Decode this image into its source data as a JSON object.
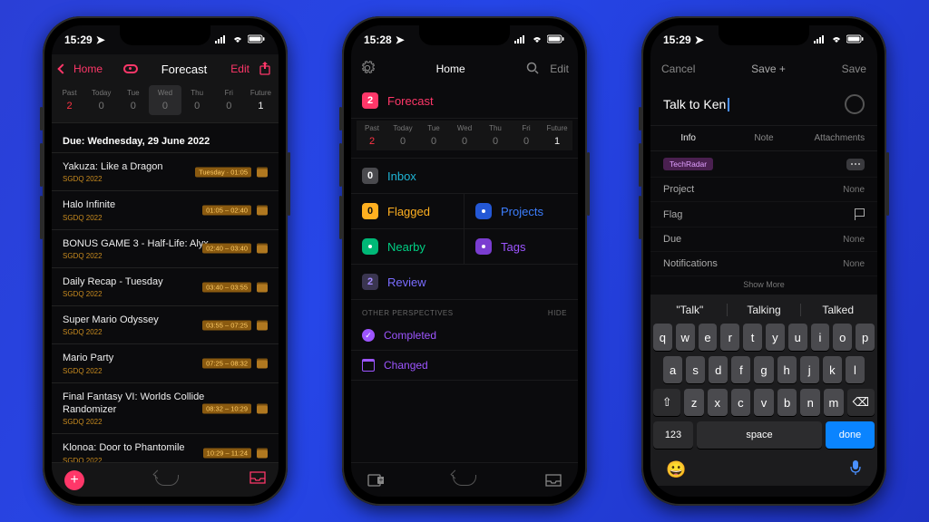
{
  "status": {
    "time_left": "15:29",
    "time_center": "15:28",
    "time_right": "15:29",
    "location_arrow": "↗"
  },
  "left": {
    "nav": {
      "back": "Home",
      "title": "Forecast",
      "edit": "Edit"
    },
    "days": [
      {
        "label": "Past",
        "count": "2",
        "cls": "red"
      },
      {
        "label": "Today",
        "count": "0",
        "cls": ""
      },
      {
        "label": "Tue",
        "count": "0",
        "cls": ""
      },
      {
        "label": "Wed",
        "count": "0",
        "cls": "",
        "sel": true
      },
      {
        "label": "Thu",
        "count": "0",
        "cls": ""
      },
      {
        "label": "Fri",
        "count": "0",
        "cls": ""
      },
      {
        "label": "Future",
        "count": "1",
        "cls": "white"
      }
    ],
    "section": "Due: Wednesday, 29 June 2022",
    "tasks": [
      {
        "title": "Yakuza: Like a Dragon",
        "sub": "SGDQ 2022",
        "badge": "Tuesday · 01:05"
      },
      {
        "title": "Halo Infinite",
        "sub": "SGDQ 2022",
        "badge": "01:05 – 02:40"
      },
      {
        "title": "BONUS GAME 3 - Half-Life: Alyx",
        "sub": "SGDQ 2022",
        "badge": "02:40 – 03:40"
      },
      {
        "title": "Daily Recap - Tuesday",
        "sub": "SGDQ 2022",
        "badge": "03:40 – 03:55"
      },
      {
        "title": "Super Mario Odyssey",
        "sub": "SGDQ 2022",
        "badge": "03:55 – 07:25"
      },
      {
        "title": "Mario Party",
        "sub": "SGDQ 2022",
        "badge": "07:25 – 08:32"
      },
      {
        "title": "Final Fantasy VI: Worlds Collide Randomizer",
        "sub": "SGDQ 2022",
        "badge": "08:32 – 10:29"
      },
      {
        "title": "Klonoa: Door to Phantomile",
        "sub": "SGDQ 2022",
        "badge": "10:29 – 11:24"
      }
    ]
  },
  "center": {
    "nav": {
      "title": "Home",
      "edit": "Edit"
    },
    "forecast": {
      "count": "2",
      "label": "Forecast"
    },
    "days": [
      {
        "label": "Past",
        "count": "2",
        "cls": "red"
      },
      {
        "label": "Today",
        "count": "0",
        "cls": ""
      },
      {
        "label": "Tue",
        "count": "0",
        "cls": ""
      },
      {
        "label": "Wed",
        "count": "0",
        "cls": ""
      },
      {
        "label": "Thu",
        "count": "0",
        "cls": ""
      },
      {
        "label": "Fri",
        "count": "0",
        "cls": ""
      },
      {
        "label": "Future",
        "count": "1",
        "cls": "white"
      }
    ],
    "inbox": {
      "count": "0",
      "label": "Inbox"
    },
    "grid": [
      {
        "count": "0",
        "label": "Flagged",
        "cls": "txt-orange",
        "badge": "bg-orange"
      },
      {
        "label": "Projects",
        "cls": "txt-blue",
        "icon": "sq-blue"
      },
      {
        "label": "Nearby",
        "cls": "txt-green",
        "icon": "sq-green"
      },
      {
        "label": "Tags",
        "cls": "txt-purple",
        "icon": "sq-purple"
      }
    ],
    "review": {
      "count": "2",
      "label": "Review"
    },
    "other": {
      "head": "OTHER PERSPECTIVES",
      "hide": "HIDE",
      "items": [
        {
          "label": "Completed"
        },
        {
          "label": "Changed"
        }
      ]
    }
  },
  "right": {
    "nav": {
      "cancel": "Cancel",
      "save_plus": "Save +",
      "save": "Save"
    },
    "task_title": "Talk to Ken",
    "tabs": [
      "Info",
      "Note",
      "Attachments"
    ],
    "tag": "TechRadar",
    "rows": [
      {
        "label": "Project",
        "val": "None"
      },
      {
        "label": "Flag",
        "val": "",
        "flag": true
      },
      {
        "label": "Due",
        "val": "None"
      },
      {
        "label": "Notifications",
        "val": "None"
      }
    ],
    "show_more": "Show More",
    "suggestions": [
      "Talk",
      "Talking",
      "Talked"
    ],
    "keys": {
      "r1": [
        "q",
        "w",
        "e",
        "r",
        "t",
        "y",
        "u",
        "i",
        "o",
        "p"
      ],
      "r2": [
        "a",
        "s",
        "d",
        "f",
        "g",
        "h",
        "j",
        "k",
        "l"
      ],
      "r3": [
        "z",
        "x",
        "c",
        "v",
        "b",
        "n",
        "m"
      ],
      "shift": "⇧",
      "bksp": "⌫",
      "num": "123",
      "space": "space",
      "done": "done"
    }
  }
}
